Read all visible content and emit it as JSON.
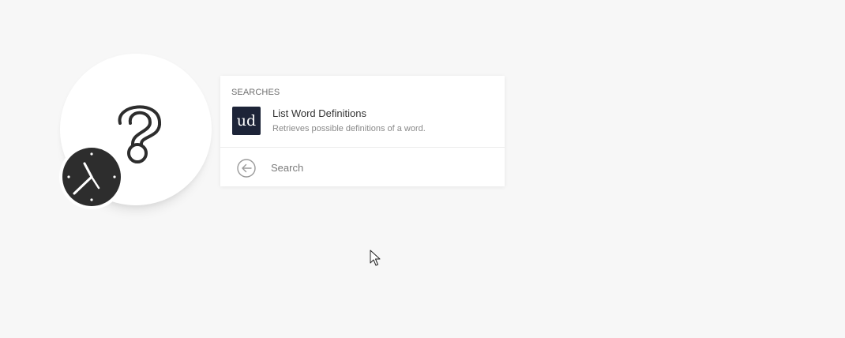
{
  "canvas": {
    "background_color": "#f7f7f7",
    "module_icon": "question-mark-icon",
    "schedule_badge_icon": "clock-icon",
    "badge_color": "#2d2d2d"
  },
  "popup": {
    "section_header": "SEARCHES",
    "results": [
      {
        "logo_text": "ud",
        "logo_color": "#1d2438",
        "title": "List Word Definitions",
        "description": "Retrieves possible definitions of a word."
      }
    ],
    "back_icon": "arrow-left-circle-icon",
    "search": {
      "placeholder": "Search",
      "value": ""
    }
  },
  "cursor": {
    "icon": "mouse-pointer-icon"
  }
}
